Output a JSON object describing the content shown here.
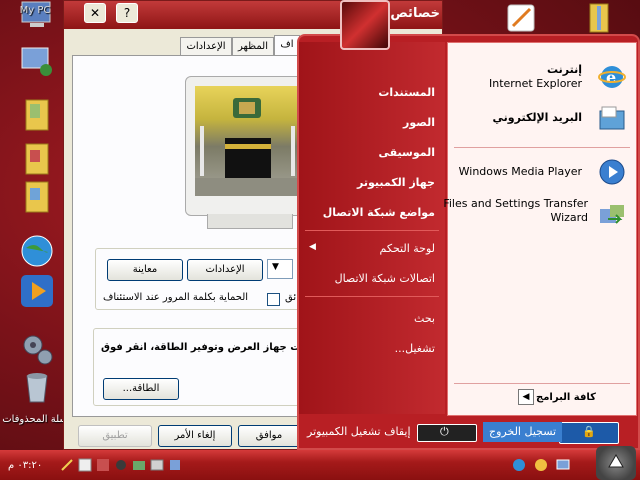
{
  "desktop": {
    "icons": [
      {
        "name": "my-computer-icon",
        "label": "My PC"
      },
      {
        "name": "network-icon",
        "label": ""
      },
      {
        "name": "folder-icon-1",
        "label": ""
      },
      {
        "name": "folder-icon-2",
        "label": ""
      },
      {
        "name": "folder-icon-3",
        "label": ""
      },
      {
        "name": "internet-globe-icon",
        "label": ""
      },
      {
        "name": "media-player-icon",
        "label": ""
      },
      {
        "name": "settings-gears-icon",
        "label": ""
      },
      {
        "name": "recycle-bin-icon",
        "label": "سلة المحذوفات"
      }
    ]
  },
  "dialog": {
    "title": "خصائص الع",
    "help_btn": "?",
    "close_btn": "✕",
    "tabs": [
      "الإعدادات",
      "المظهر",
      "اف"
    ],
    "screensaver_settings_btn": "الإعدادات",
    "preview_btn": "معاينة",
    "password_checkbox_label": "الحماية بكلمة المرور عند الاستئناف",
    "wait_label": "ائق",
    "power_text": "ت جهاز العرض وتوفير الطاقة، انقر فوق",
    "power_btn": "الطاقة...",
    "ok_btn": "موافق",
    "cancel_btn": "إلغاء الأمر",
    "apply_btn": "تطبيق"
  },
  "start_menu": {
    "pinned": [
      {
        "name": "internet",
        "title": "إنترنت",
        "sub": "Internet Explorer"
      },
      {
        "name": "email",
        "title": "البريد الإلكتروني",
        "sub": ""
      }
    ],
    "recent": [
      {
        "name": "windows-media-player",
        "title": "Windows Media Player"
      },
      {
        "name": "files-settings-transfer",
        "title": "Files and Settings Transfer",
        "title2": "Wizard"
      }
    ],
    "all_programs": "كافة البرامج",
    "right_items": [
      "المستندات",
      "الصور",
      "الموسيقى",
      "جهاز الكمبيوتر",
      "مواضع شبكة الاتصال",
      "لوحة التحكم",
      "اتصالات شبكة الاتصال",
      "بحث",
      "تشغيل..."
    ],
    "logoff": "تسجيل الخروج",
    "shutdown": "إيقاف تشغيل الكمبيوتر"
  },
  "taskbar": {
    "clock": "٠٣:٢٠ م"
  },
  "colors": {
    "accent": "#b81f24",
    "panel": "#fff4f2",
    "dialog_bg": "#ece9d8"
  }
}
